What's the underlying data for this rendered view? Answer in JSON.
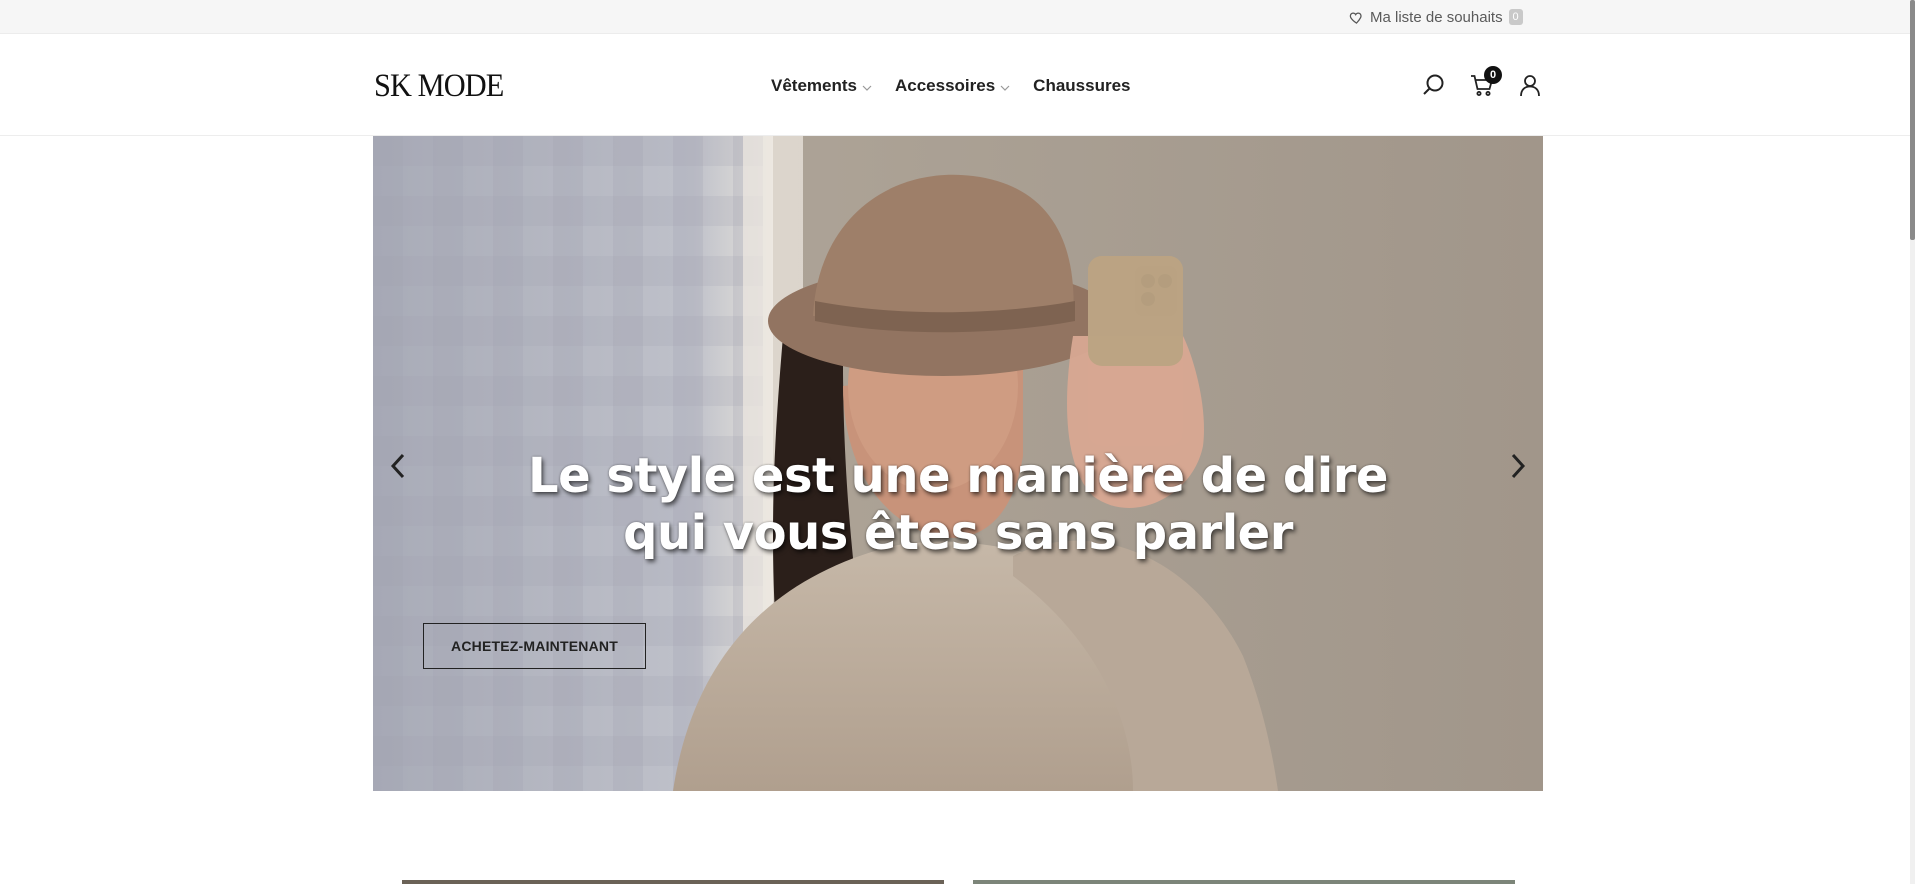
{
  "topbar": {
    "wishlist_label": "Ma liste de souhaits",
    "wishlist_count": "0"
  },
  "header": {
    "logo_text": "SK MODE",
    "nav": [
      {
        "label": "Vêtements",
        "has_dropdown": true
      },
      {
        "label": "Accessoires",
        "has_dropdown": true
      },
      {
        "label": "Chaussures",
        "has_dropdown": false
      }
    ],
    "icons": [
      "search-icon",
      "cart-icon",
      "user-icon"
    ],
    "cart_count": "0"
  },
  "hero": {
    "title_line1": "Le style est une manière de dire",
    "title_line2": "qui vous êtes sans parler",
    "cta_label": "ACHETEZ-MAINTENANT",
    "colors": {
      "title": "#ffffff",
      "cta_border": "#222222",
      "wall": "#a49a8c",
      "curtain": "#b7b9c3",
      "hat": "#9c7e66",
      "sweater": "#bcac9c"
    }
  }
}
